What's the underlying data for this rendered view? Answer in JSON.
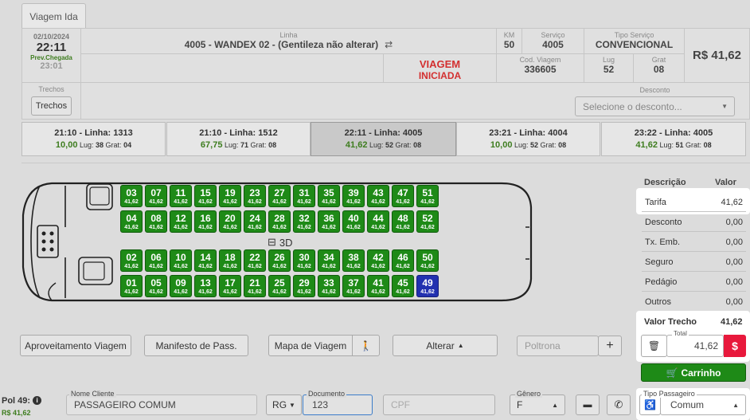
{
  "tab": {
    "label": "Viagem Ida"
  },
  "header": {
    "date": "02/10/2024",
    "time": "22:11",
    "arrival_label": "Prev.Chegada",
    "arrival_time": "23:01",
    "linha_label": "Linha",
    "linha_value": "4005 - WANDEX 02 - (Gentileza não alterar)",
    "status_line1": "VIAGEM",
    "status_line2": "INICIADA",
    "km_label": "KM",
    "km_value": "50",
    "servico_label": "Serviço",
    "servico_value": "4005",
    "tipo_servico_label": "Tipo Serviço",
    "tipo_servico_value": "CONVENCIONAL",
    "price": "R$ 41,62",
    "cod_viagem_label": "Cod. Viagem",
    "cod_viagem_value": "336605",
    "lug_label": "Lug",
    "lug_value": "52",
    "grat_label": "Grat",
    "grat_value": "08",
    "trechos_label": "Trechos",
    "trechos_button": "Trechos",
    "desconto_label": "Desconto",
    "desconto_placeholder": "Selecione o desconto..."
  },
  "trips": [
    {
      "time": "21:10 - Linha: 1313",
      "price": "10,00",
      "lug": "38",
      "grat": "04"
    },
    {
      "time": "21:10 - Linha: 1512",
      "price": "67,75",
      "lug": "71",
      "grat": "08"
    },
    {
      "time": "22:11 - Linha: 4005",
      "price": "41,62",
      "lug": "52",
      "grat": "08"
    },
    {
      "time": "23:21 - Linha: 4004",
      "price": "10,00",
      "lug": "52",
      "grat": "08"
    },
    {
      "time": "23:22 - Linha: 4005",
      "price": "41,62",
      "lug": "51",
      "grat": "08"
    }
  ],
  "trip_labels": {
    "lug": "Lug:",
    "grat": "Grat:"
  },
  "bus": {
    "label": "3D",
    "seat_price": "41,62",
    "row1": [
      "03",
      "07",
      "11",
      "15",
      "19",
      "23",
      "27",
      "31",
      "35",
      "39",
      "43",
      "47",
      "51"
    ],
    "row2": [
      "04",
      "08",
      "12",
      "16",
      "20",
      "24",
      "28",
      "32",
      "36",
      "40",
      "44",
      "48",
      "52"
    ],
    "row3": [
      "02",
      "06",
      "10",
      "14",
      "18",
      "22",
      "26",
      "30",
      "34",
      "38",
      "42",
      "46",
      "50"
    ],
    "row4": [
      "01",
      "05",
      "09",
      "13",
      "17",
      "21",
      "25",
      "29",
      "33",
      "37",
      "41",
      "45",
      "49"
    ],
    "selected_seat": "49"
  },
  "prices": {
    "col_desc": "Descrição",
    "col_val": "Valor",
    "rows": [
      {
        "label": "Tarifa",
        "value": "41,62"
      },
      {
        "label": "Desconto",
        "value": "0,00"
      },
      {
        "label": "Tx. Emb.",
        "value": "0,00"
      },
      {
        "label": "Seguro",
        "value": "0,00"
      },
      {
        "label": "Pedágio",
        "value": "0,00"
      },
      {
        "label": "Outros",
        "value": "0,00"
      }
    ],
    "valor_trecho_label": "Valor Trecho",
    "valor_trecho_value": "41,62",
    "total_label": "Total",
    "total_value": "41,62"
  },
  "actions": {
    "aproveitamento": "Aproveitamento Viagem",
    "manifesto": "Manifesto de Pass.",
    "mapa": "Mapa de Viagem",
    "alterar": "Alterar",
    "poltrona_placeholder": "Poltrona",
    "carrinho": "Carrinho"
  },
  "form": {
    "pol_label": "Pol 49:",
    "pol_price": "R$ 41,62",
    "nome_label": "Nome Cliente",
    "nome_value": "PASSAGEIRO COMUM",
    "doc_type": "RG",
    "documento_label": "Documento",
    "documento_value": "123",
    "cpf_placeholder": "CPF",
    "genero_label": "Gênero",
    "genero_value": "F",
    "tipo_passageiro_label": "Tipo Passageiro",
    "tipo_passageiro_value": "Comum"
  },
  "colors": {
    "seat_green": "#1e8a17",
    "seat_selected": "#2231b0",
    "price_green": "#3e7d1f",
    "status_red": "#d32f2f",
    "cart_green": "#1e8a17",
    "pay_red": "#e8193c"
  }
}
